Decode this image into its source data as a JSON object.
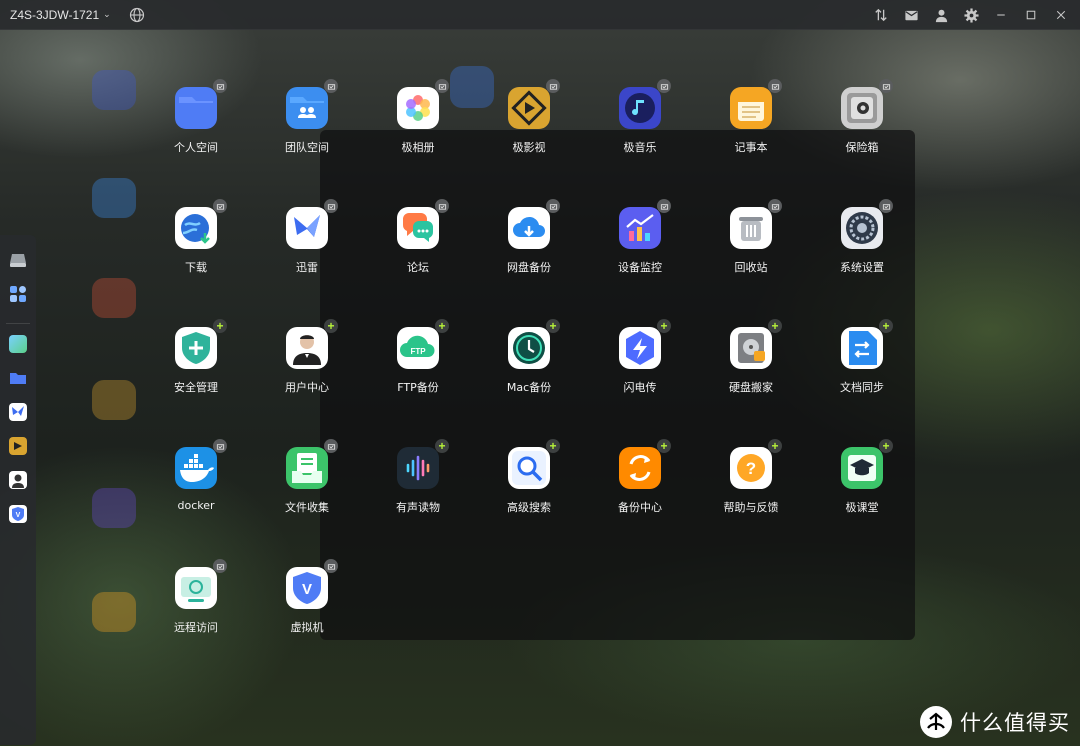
{
  "titlebar": {
    "device_name": "Z4S-3JDW-1721",
    "icons": [
      "globe-icon",
      "sort-icon",
      "mail-icon",
      "user-icon",
      "settings-icon",
      "minimize-icon",
      "maximize-icon",
      "close-icon"
    ]
  },
  "dock": {
    "items": [
      "drive-icon",
      "app-grid-icon",
      "photos-icon",
      "folder-icon",
      "thunder-icon",
      "video-icon",
      "user-center-icon",
      "vm-icon"
    ]
  },
  "apps": [
    {
      "label": "个人空间",
      "badge": "check",
      "icon": "folder-icon",
      "color": "#4f7cf5"
    },
    {
      "label": "团队空间",
      "badge": "check",
      "icon": "team-folder-icon",
      "color": "#3c8ef0"
    },
    {
      "label": "极相册",
      "badge": "check",
      "icon": "photos-icon",
      "color": "#ffffff"
    },
    {
      "label": "极影视",
      "badge": "check",
      "icon": "video-icon",
      "color": "#d9a430"
    },
    {
      "label": "极音乐",
      "badge": "check",
      "icon": "music-icon",
      "color": "#3b46c9"
    },
    {
      "label": "记事本",
      "badge": "check",
      "icon": "notes-icon",
      "color": "#f5a623"
    },
    {
      "label": "保险箱",
      "badge": "check",
      "icon": "safe-icon",
      "color": "#cfcfcf"
    },
    {
      "label": "下载",
      "badge": "check",
      "icon": "download-icon",
      "color": "#ffffff"
    },
    {
      "label": "迅雷",
      "badge": "check",
      "icon": "thunder-icon",
      "color": "#ffffff"
    },
    {
      "label": "论坛",
      "badge": "check",
      "icon": "forum-icon",
      "color": "#ffffff"
    },
    {
      "label": "网盘备份",
      "badge": "check",
      "icon": "cloud-backup-icon",
      "color": "#ffffff"
    },
    {
      "label": "设备监控",
      "badge": "check",
      "icon": "monitor-icon",
      "color": "#5b5ef0"
    },
    {
      "label": "回收站",
      "badge": "check",
      "icon": "trash-icon",
      "color": "#ffffff"
    },
    {
      "label": "系统设置",
      "badge": "check",
      "icon": "system-settings-icon",
      "color": "#e8eaef"
    },
    {
      "label": "安全管理",
      "badge": "plus",
      "icon": "shield-icon",
      "color": "#ffffff"
    },
    {
      "label": "用户中心",
      "badge": "plus",
      "icon": "user-center-icon",
      "color": "#ffffff"
    },
    {
      "label": "FTP备份",
      "badge": "plus",
      "icon": "ftp-icon",
      "color": "#ffffff"
    },
    {
      "label": "Mac备份",
      "badge": "plus",
      "icon": "mac-backup-icon",
      "color": "#ffffff"
    },
    {
      "label": "闪电传",
      "badge": "plus",
      "icon": "flash-transfer-icon",
      "color": "#ffffff"
    },
    {
      "label": "硬盘搬家",
      "badge": "plus",
      "icon": "disk-move-icon",
      "color": "#ffffff"
    },
    {
      "label": "文档同步",
      "badge": "plus",
      "icon": "doc-sync-icon",
      "color": "#ffffff"
    },
    {
      "label": "docker",
      "badge": "check",
      "icon": "docker-icon",
      "color": "#1d91e6"
    },
    {
      "label": "文件收集",
      "badge": "check",
      "icon": "file-collect-icon",
      "color": "#3cc46a"
    },
    {
      "label": "有声读物",
      "badge": "plus",
      "icon": "audiobook-icon",
      "color": "#1f2b36"
    },
    {
      "label": "高级搜索",
      "badge": "plus",
      "icon": "advanced-search-icon",
      "color": "#ffffff"
    },
    {
      "label": "备份中心",
      "badge": "plus",
      "icon": "backup-center-icon",
      "color": "#ff8a00"
    },
    {
      "label": "帮助与反馈",
      "badge": "plus",
      "icon": "help-icon",
      "color": "#ffffff"
    },
    {
      "label": "极课堂",
      "badge": "plus",
      "icon": "classroom-icon",
      "color": "#3cc46a"
    },
    {
      "label": "远程访问",
      "badge": "check",
      "icon": "remote-access-icon",
      "color": "#ffffff"
    },
    {
      "label": "虚拟机",
      "badge": "check",
      "icon": "vm-icon",
      "color": "#ffffff"
    }
  ],
  "watermark": {
    "text": "什么值得买",
    "icon": "zdm-logo-icon"
  }
}
